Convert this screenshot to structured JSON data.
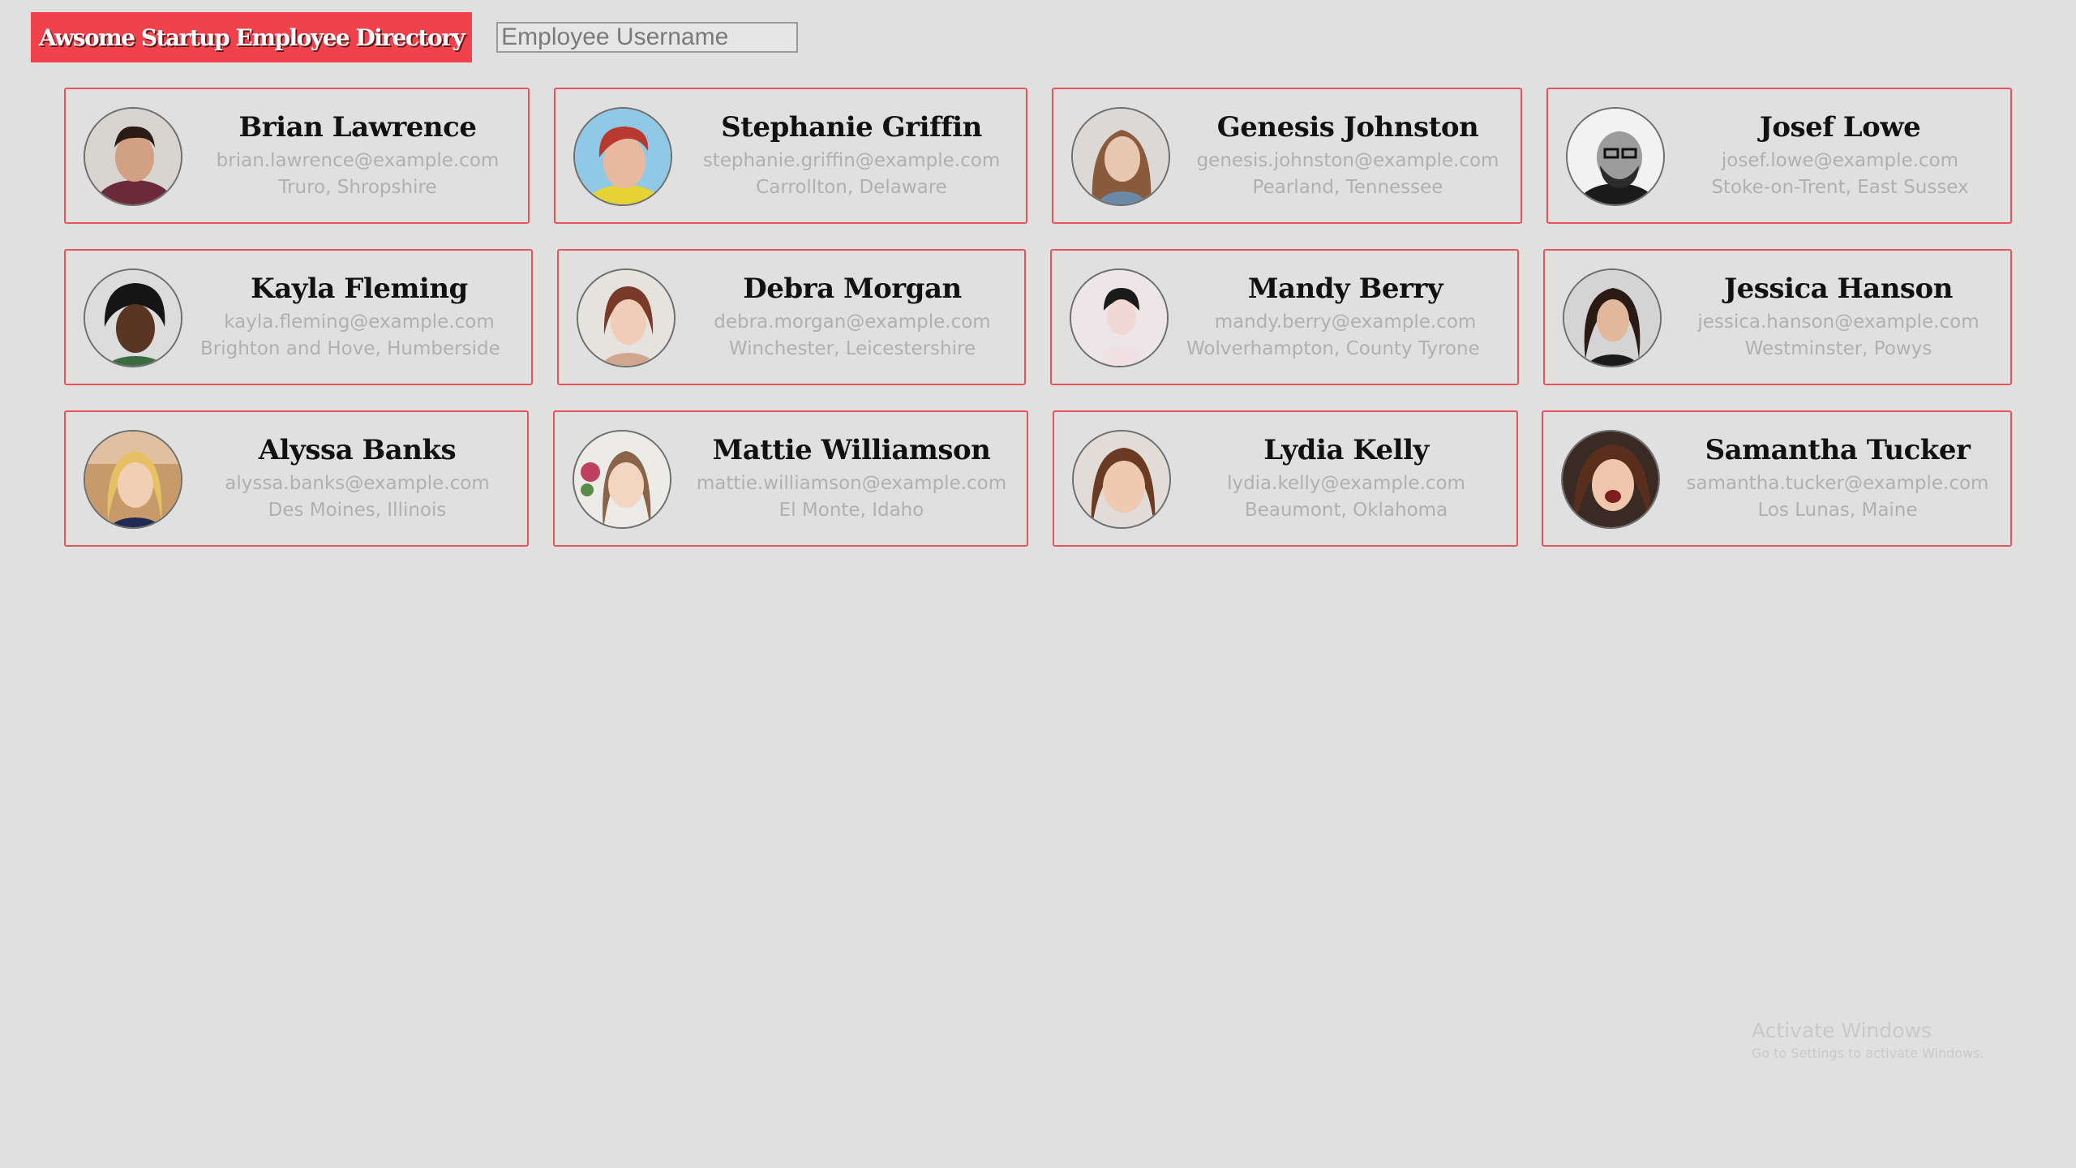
{
  "header": {
    "title": "Awsome Startup Employee Directory",
    "search_placeholder": "Employee Username",
    "colors": {
      "brand_bg": "#f0424d",
      "card_border": "#e7545b"
    }
  },
  "employees": [
    {
      "name": "Brian Lawrence",
      "email": "brian.lawrence@example.com",
      "location": "Truro, Shropshire",
      "avatar": "avatar-photo"
    },
    {
      "name": "Stephanie Griffin",
      "email": "stephanie.griffin@example.com",
      "location": "Carrollton, Delaware",
      "avatar": "avatar-photo"
    },
    {
      "name": "Genesis Johnston",
      "email": "genesis.johnston@example.com",
      "location": "Pearland, Tennessee",
      "avatar": "avatar-photo"
    },
    {
      "name": "Josef Lowe",
      "email": "josef.lowe@example.com",
      "location": "Stoke-on-Trent, East Sussex",
      "avatar": "avatar-photo"
    },
    {
      "name": "Kayla Fleming",
      "email": "kayla.fleming@example.com",
      "location": "Brighton and Hove, Humberside",
      "avatar": "avatar-photo"
    },
    {
      "name": "Debra Morgan",
      "email": "debra.morgan@example.com",
      "location": "Winchester, Leicestershire",
      "avatar": "avatar-photo"
    },
    {
      "name": "Mandy Berry",
      "email": "mandy.berry@example.com",
      "location": "Wolverhampton, County Tyrone",
      "avatar": "avatar-photo"
    },
    {
      "name": "Jessica Hanson",
      "email": "jessica.hanson@example.com",
      "location": "Westminster, Powys",
      "avatar": "avatar-photo"
    },
    {
      "name": "Alyssa Banks",
      "email": "alyssa.banks@example.com",
      "location": "Des Moines, Illinois",
      "avatar": "avatar-photo"
    },
    {
      "name": "Mattie Williamson",
      "email": "mattie.williamson@example.com",
      "location": "El Monte, Idaho",
      "avatar": "avatar-photo"
    },
    {
      "name": "Lydia Kelly",
      "email": "lydia.kelly@example.com",
      "location": "Beaumont, Oklahoma",
      "avatar": "avatar-photo"
    },
    {
      "name": "Samantha Tucker",
      "email": "samantha.tucker@example.com",
      "location": "Los Lunas, Maine",
      "avatar": "avatar-photo"
    }
  ],
  "watermark": {
    "title": "Activate Windows",
    "subtitle": "Go to Settings to activate Windows."
  }
}
